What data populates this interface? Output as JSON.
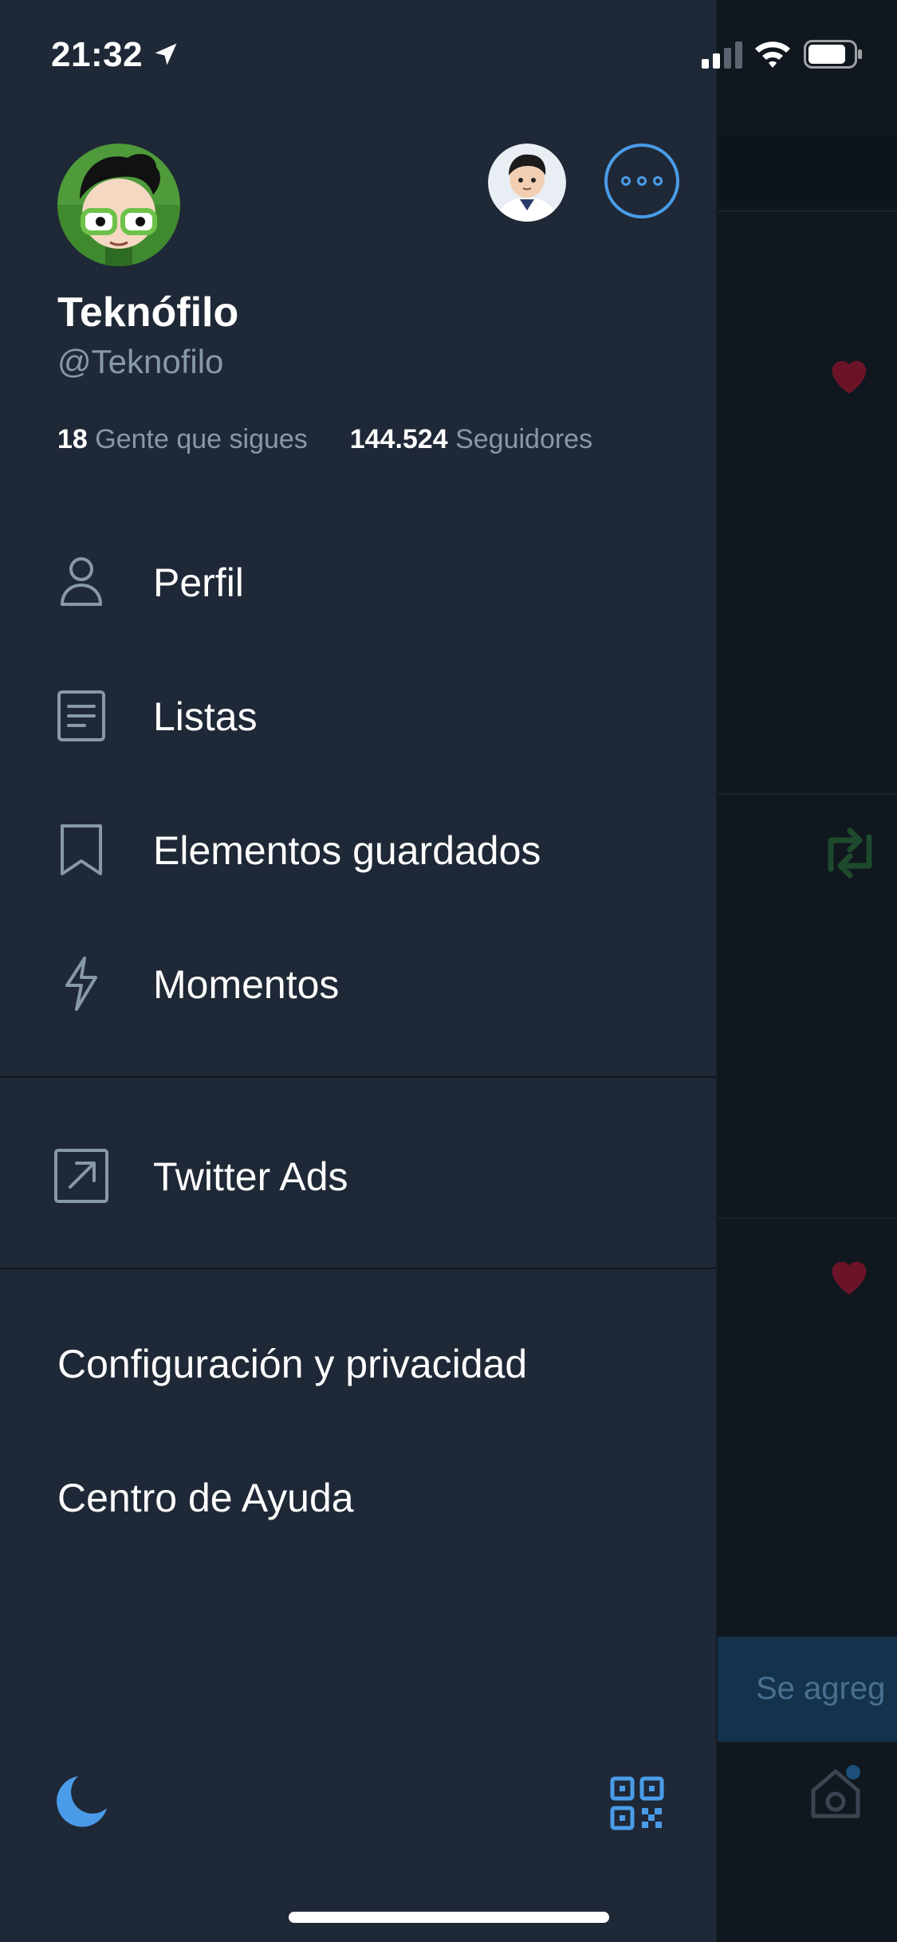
{
  "status_bar": {
    "time": "21:32"
  },
  "profile": {
    "name": "Teknófilo",
    "handle": "@Teknofilo",
    "following_count": "18",
    "following_label": "Gente que sigues",
    "followers_count": "144.524",
    "followers_label": "Seguidores"
  },
  "menu": {
    "items": [
      {
        "label": "Perfil",
        "icon": "person-icon"
      },
      {
        "label": "Listas",
        "icon": "list-icon"
      },
      {
        "label": "Elementos guardados",
        "icon": "bookmark-icon"
      },
      {
        "label": "Momentos",
        "icon": "lightning-icon"
      }
    ],
    "ads": {
      "label": "Twitter Ads",
      "icon": "external-link-icon"
    },
    "settings_label": "Configuración y privacidad",
    "help_label": "Centro de Ayuda"
  },
  "background": {
    "banner_text": "Se agreg"
  },
  "colors": {
    "accent": "#4a9ce8",
    "drawer_bg": "#1f2836",
    "secondary_text": "#8899a6"
  }
}
